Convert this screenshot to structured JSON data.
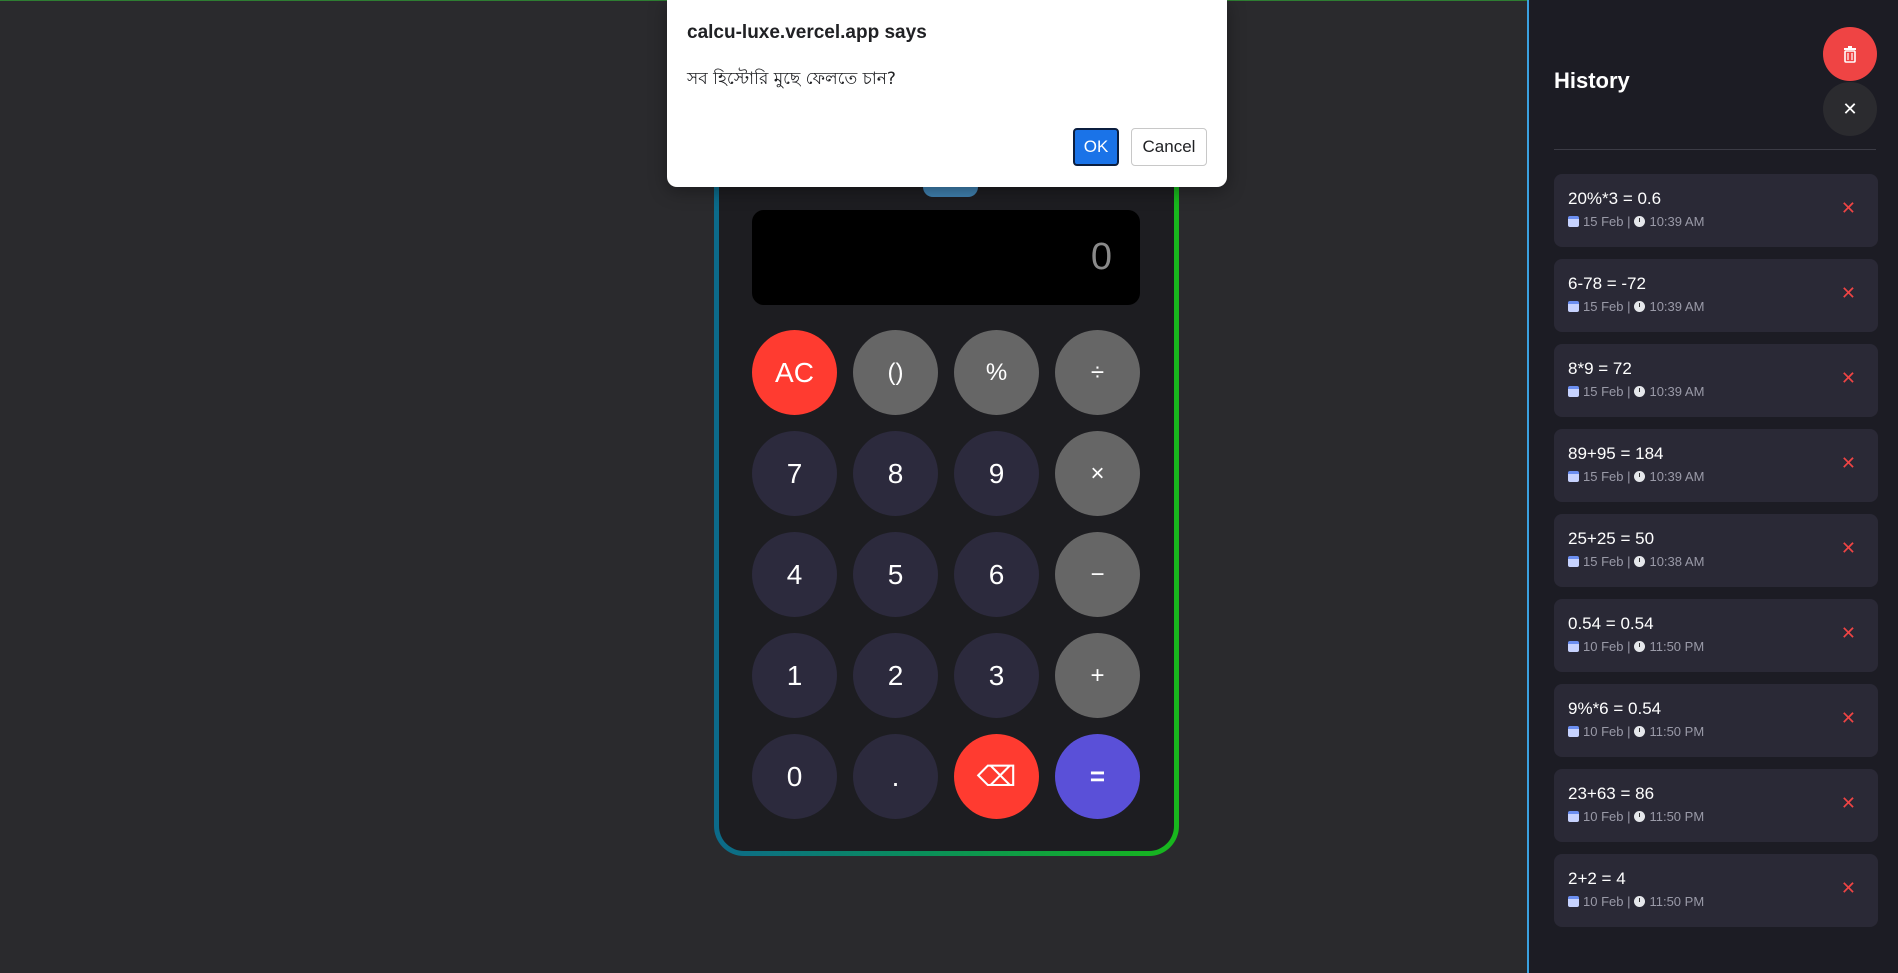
{
  "dialog": {
    "title": "calcu-luxe.vercel.app says",
    "message": "সব হিস্টোরি মুছে ফেলতে চান?",
    "ok_label": "OK",
    "cancel_label": "Cancel"
  },
  "calculator": {
    "display_value": "0",
    "keys": [
      {
        "label": "AC",
        "style": "red",
        "name": "ac-key"
      },
      {
        "label": "()",
        "style": "op",
        "name": "parentheses-key"
      },
      {
        "label": "%",
        "style": "op",
        "name": "percent-key"
      },
      {
        "label": "÷",
        "style": "op",
        "name": "divide-key"
      },
      {
        "label": "7",
        "style": "num",
        "name": "digit-7-key"
      },
      {
        "label": "8",
        "style": "num",
        "name": "digit-8-key"
      },
      {
        "label": "9",
        "style": "num",
        "name": "digit-9-key"
      },
      {
        "label": "×",
        "style": "op",
        "name": "multiply-key"
      },
      {
        "label": "4",
        "style": "num",
        "name": "digit-4-key"
      },
      {
        "label": "5",
        "style": "num",
        "name": "digit-5-key"
      },
      {
        "label": "6",
        "style": "num",
        "name": "digit-6-key"
      },
      {
        "label": "−",
        "style": "op",
        "name": "subtract-key"
      },
      {
        "label": "1",
        "style": "num",
        "name": "digit-1-key"
      },
      {
        "label": "2",
        "style": "num",
        "name": "digit-2-key"
      },
      {
        "label": "3",
        "style": "num",
        "name": "digit-3-key"
      },
      {
        "label": "+",
        "style": "op",
        "name": "add-key"
      },
      {
        "label": "0",
        "style": "num",
        "name": "digit-0-key"
      },
      {
        "label": ".",
        "style": "num",
        "name": "decimal-key"
      },
      {
        "label": "⌫",
        "style": "red",
        "name": "backspace-key"
      },
      {
        "label": "=",
        "style": "eq",
        "name": "equals-key"
      }
    ]
  },
  "history": {
    "title": "History",
    "clear_icon": "trash-icon",
    "close_label": "✕",
    "delete_label": "✕",
    "items": [
      {
        "expression": "20%*3 = 0.6",
        "date": "15 Feb |",
        "time": "10:39 AM"
      },
      {
        "expression": "6-78 = -72",
        "date": "15 Feb |",
        "time": "10:39 AM"
      },
      {
        "expression": "8*9 = 72",
        "date": "15 Feb |",
        "time": "10:39 AM"
      },
      {
        "expression": "89+95 = 184",
        "date": "15 Feb |",
        "time": "10:39 AM"
      },
      {
        "expression": "25+25 = 50",
        "date": "15 Feb |",
        "time": "10:38 AM"
      },
      {
        "expression": "0.54 = 0.54",
        "date": "10 Feb |",
        "time": "11:50 PM"
      },
      {
        "expression": "9%*6 = 0.54",
        "date": "10 Feb |",
        "time": "11:50 PM"
      },
      {
        "expression": "23+63 = 86",
        "date": "10 Feb |",
        "time": "11:50 PM"
      },
      {
        "expression": "2+2 = 4",
        "date": "10 Feb |",
        "time": "11:50 PM"
      }
    ]
  },
  "colors": {
    "accent": "#5a50d8",
    "danger": "#ff3b30",
    "panel_border": "#3aa1e0"
  }
}
